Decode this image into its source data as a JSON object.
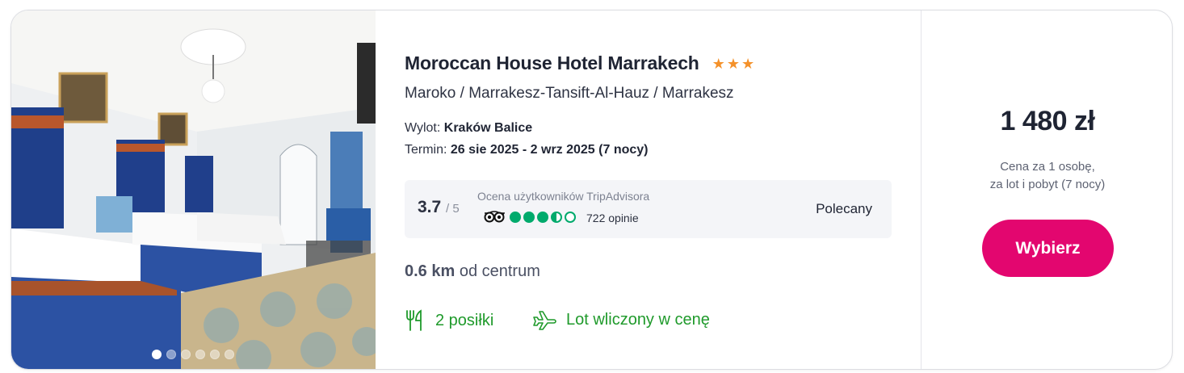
{
  "hotel": {
    "name": "Moroccan House Hotel Marrakech",
    "stars": 3,
    "location": "Maroko / Marrakesz-Tansift-Al-Hauz / Marrakesz"
  },
  "flight": {
    "label": "Wylot:",
    "value": "Kraków Balice"
  },
  "term": {
    "label": "Termin:",
    "value": "26 sie 2025 - 2 wrz 2025 (7 nocy)"
  },
  "tripadvisor": {
    "score": "3.7",
    "scale": "/ 5",
    "label": "Ocena użytkowników TripAdvisora",
    "rating": 3.5,
    "reviews": "722 opinie",
    "recommendation": "Polecany"
  },
  "distance": {
    "value": "0.6 km",
    "suffix": "od centrum"
  },
  "features": {
    "meals": "2 posiłki",
    "flight": "Lot wliczony w cenę"
  },
  "price": {
    "amount": "1 480 zł",
    "note_line1": "Cena za 1 osobę,",
    "note_line2": "za lot i pobyt (7 nocy)",
    "button": "Wybierz"
  },
  "gallery": {
    "count": 6,
    "active": 1
  },
  "colors": {
    "accent": "#e3066f",
    "star": "#f4912a",
    "feature": "#1f9a2b",
    "tripadvisor": "#00aa6c"
  }
}
